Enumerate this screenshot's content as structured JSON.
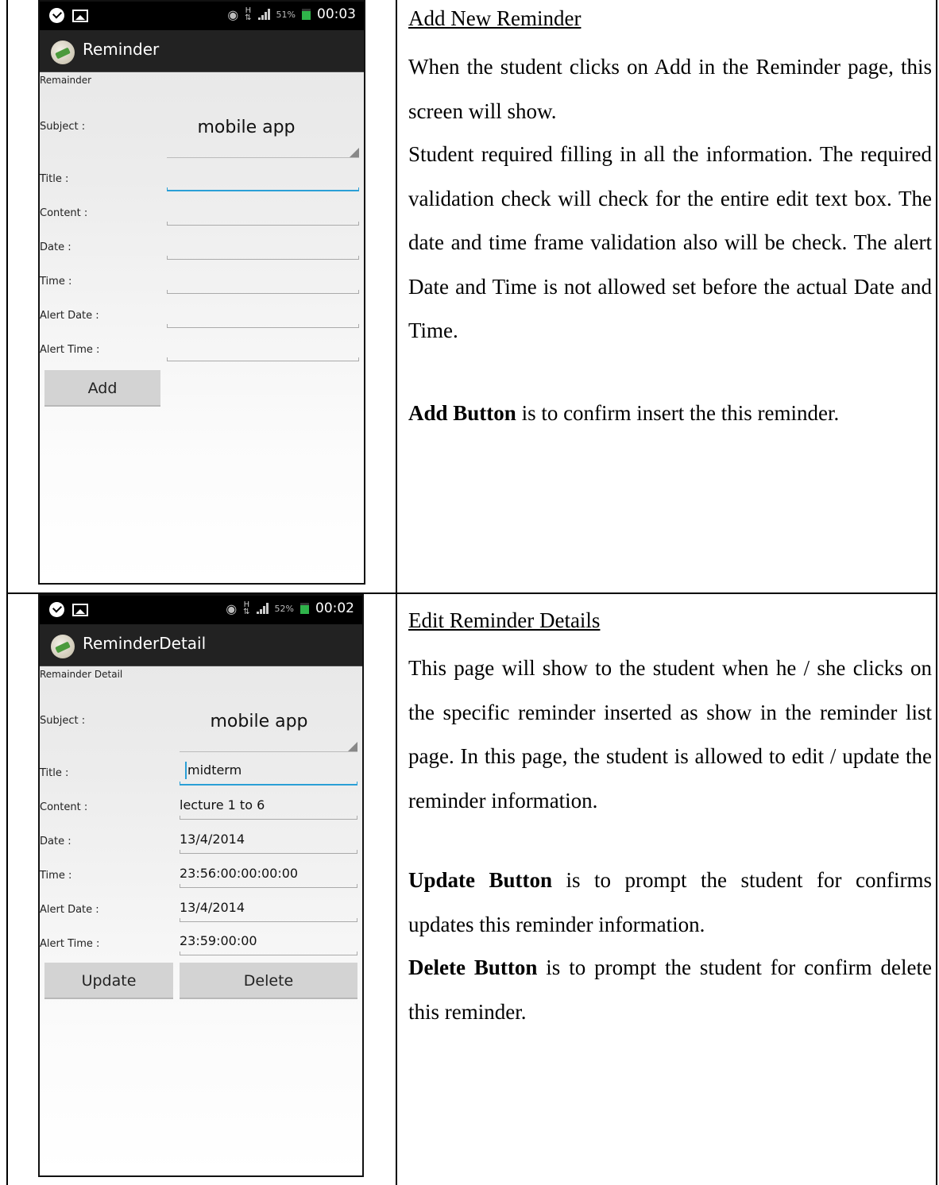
{
  "section_add": {
    "heading": "Add New Reminder",
    "para_intro": "When the student clicks on Add in the Reminder page, this screen will show.",
    "para_validation": "Student required filling in all the information. The required validation check will check for the entire edit text box. The date and time frame validation also will be check. The alert Date and Time is not allowed set before the actual Date and Time.",
    "add_button_bold": "Add Button",
    "add_button_desc": "is to confirm insert the this reminder."
  },
  "section_edit": {
    "heading": "Edit Reminder Details",
    "para_intro": "This page will show to the student when he / she clicks on the specific reminder inserted as show in the reminder list page. In this page, the student is allowed to edit / update the reminder information.",
    "update_button_bold": "Update Button",
    "update_button_desc": "is to prompt the student for confirms updates this reminder information.",
    "delete_button_bold": "Delete Button",
    "delete_button_desc": "is to prompt the student for confirm delete this reminder."
  },
  "phone_add": {
    "status": {
      "battery_pct": "51%",
      "time": "00:03"
    },
    "app_title": "Reminder",
    "screen_label": "Remainder",
    "subject_label": "Subject :",
    "subject_value": "mobile app",
    "title_label": "Title :",
    "content_label": "Content :",
    "date_label": "Date :",
    "time_label": "Time :",
    "alert_date_label": "Alert Date :",
    "alert_time_label": "Alert Time :",
    "add_button": "Add"
  },
  "phone_edit": {
    "status": {
      "battery_pct": "52%",
      "time": "00:02"
    },
    "app_title": "ReminderDetail",
    "screen_label": "Remainder Detail",
    "subject_label": "Subject :",
    "subject_value": "mobile app",
    "title_label": "Title :",
    "title_value": "midterm",
    "content_label": "Content :",
    "content_value": "lecture 1 to 6",
    "date_label": "Date :",
    "date_value": "13/4/2014",
    "time_label": "Time :",
    "time_value": "23:56:00:00:00:00",
    "alert_date_label": "Alert Date :",
    "alert_date_value": "13/4/2014",
    "alert_time_label": "Alert Time :",
    "alert_time_value": "23:59:00:00",
    "update_button": "Update",
    "delete_button": "Delete"
  },
  "icons": {
    "status_left": [
      "message-icon",
      "image-icon"
    ],
    "status_right": [
      "eye-icon",
      "hspa-icon",
      "signal-icon",
      "battery-icon"
    ],
    "app": "app-logo-icon",
    "spinner": "dropdown-arrow-icon"
  }
}
